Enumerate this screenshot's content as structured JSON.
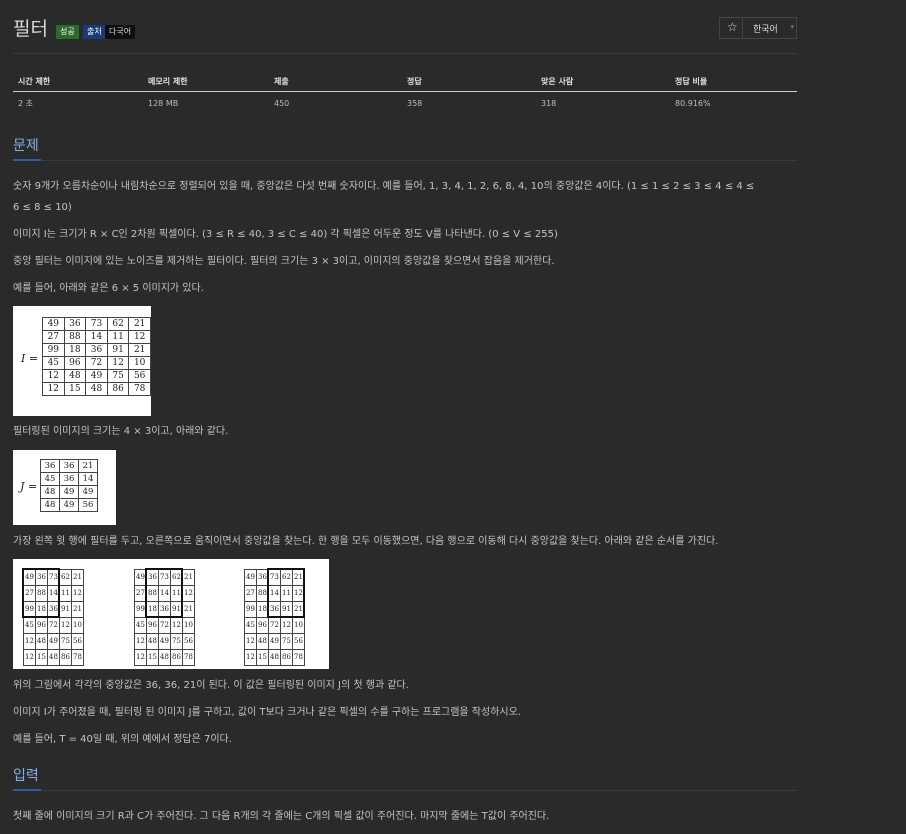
{
  "header": {
    "title": "필터",
    "badges": [
      "성공",
      "출처",
      "다국어"
    ],
    "language": "한국어"
  },
  "stats": {
    "headers": [
      "시간 제한",
      "메모리 제한",
      "제출",
      "정답",
      "맞은 사람",
      "정답 비율"
    ],
    "values": [
      "2 초",
      "128 MB",
      "450",
      "358",
      "318",
      "80.916%"
    ]
  },
  "problem": {
    "heading": "문제",
    "p1": "숫자 9개가 오름차순이나 내림차순으로 정렬되어 있을 때, 중앙값은 다섯 번째 숫자이다. 예를 들어, 1, 3, 4, 1, 2, 6, 8, 4, 10의 중앙값은 4이다. (1 ≤ 1 ≤ 2 ≤ 3 ≤ 4 ≤ 4 ≤",
    "p1b": "6 ≤ 8 ≤ 10)",
    "p2": "이미지 I는 크기가 R × C인 2차원 픽셀이다. (3 ≤ R ≤ 40, 3 ≤ C ≤ 40) 각 픽셀은 어두운 정도 V를 나타낸다. (0 ≤ V ≤ 255)",
    "p3": "중앙 필터는 이미지에 있는 노이즈를 제거하는 필터이다. 필터의 크기는 3 × 3이고, 이미지의 중앙값을 찾으면서 잡음을 제거한다.",
    "p4": "예를 들어, 아래와 같은 6 × 5 이미지가 있다.",
    "p5": "필터링된 이미지의 크기는 4 × 3이고, 아래와 같다.",
    "p6": "가장 왼쪽 윗 행에 필터를 두고, 오른쪽으로 움직이면서 중앙값을 찾는다. 한 행을 모두 이동했으면, 다음 행으로 이동해 다시 중앙값을 찾는다. 아래와 같은 순서를 가진다.",
    "p7": "위의 그림에서 각각의 중앙값은 36, 36, 21이 된다. 이 값은 필터링된 이미지 J의 첫 행과 같다.",
    "p8": "이미지 I가 주어졌을 때, 필터링 된 이미지 J를 구하고, 값이 T보다 크거나 같은 픽셀의 수를 구하는 프로그램을 작성하시오.",
    "p9": "예를 들어, T = 40일 때, 위의 예에서 정답은 7이다."
  },
  "figures": {
    "i_label": "I =",
    "j_label": "J =",
    "image_i": [
      [
        49,
        36,
        73,
        62,
        21
      ],
      [
        27,
        88,
        14,
        11,
        12
      ],
      [
        99,
        18,
        36,
        91,
        21
      ],
      [
        45,
        96,
        72,
        12,
        10
      ],
      [
        12,
        48,
        49,
        75,
        56
      ],
      [
        12,
        15,
        48,
        86,
        78
      ]
    ],
    "image_j": [
      [
        36,
        36,
        21
      ],
      [
        45,
        36,
        14
      ],
      [
        48,
        49,
        49
      ],
      [
        48,
        49,
        56
      ]
    ]
  },
  "input": {
    "heading": "입력",
    "p1": "첫째 줄에 이미지의 크기 R과 C가 주어진다. 그 다음 R개의 각 줄에는 C개의 픽셀 값이 주어진다. 마지막 줄에는 T값이 주어진다."
  }
}
